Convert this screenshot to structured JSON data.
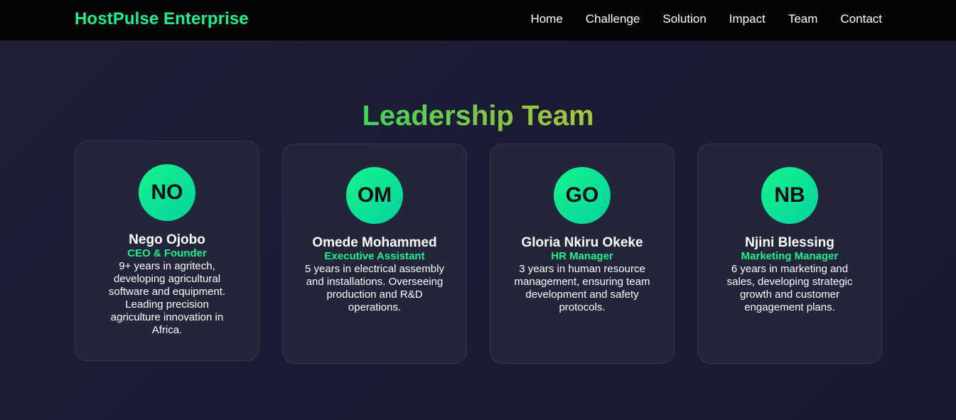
{
  "navbar": {
    "brand": "HostPulse Enterprise",
    "links": [
      "Home",
      "Challenge",
      "Solution",
      "Impact",
      "Team",
      "Contact"
    ]
  },
  "team": {
    "title": "Leadership Team",
    "members": [
      {
        "initials": "NO",
        "name": "Nego Ojobo",
        "role": "CEO & Founder",
        "bio": "9+ years in agritech, developing agricultural software and equipment. Leading precision agriculture innovation in Africa."
      },
      {
        "initials": "OM",
        "name": "Omede Mohammed",
        "role": "Executive Assistant",
        "bio": "5 years in electrical assembly and installations. Overseeing production and R&D operations."
      },
      {
        "initials": "GO",
        "name": "Gloria Nkiru Okeke",
        "role": "HR Manager",
        "bio": "3 years in human resource management, ensuring team development and safety protocols."
      },
      {
        "initials": "NB",
        "name": "Njini Blessing",
        "role": "Marketing Manager",
        "bio": "6 years in marketing and sales, developing strategic growth and customer engagement plans."
      }
    ]
  },
  "colors": {
    "accent": "#1ef08c",
    "background": "#1b1d33",
    "card": "#23253a",
    "navbar": "#050508"
  }
}
